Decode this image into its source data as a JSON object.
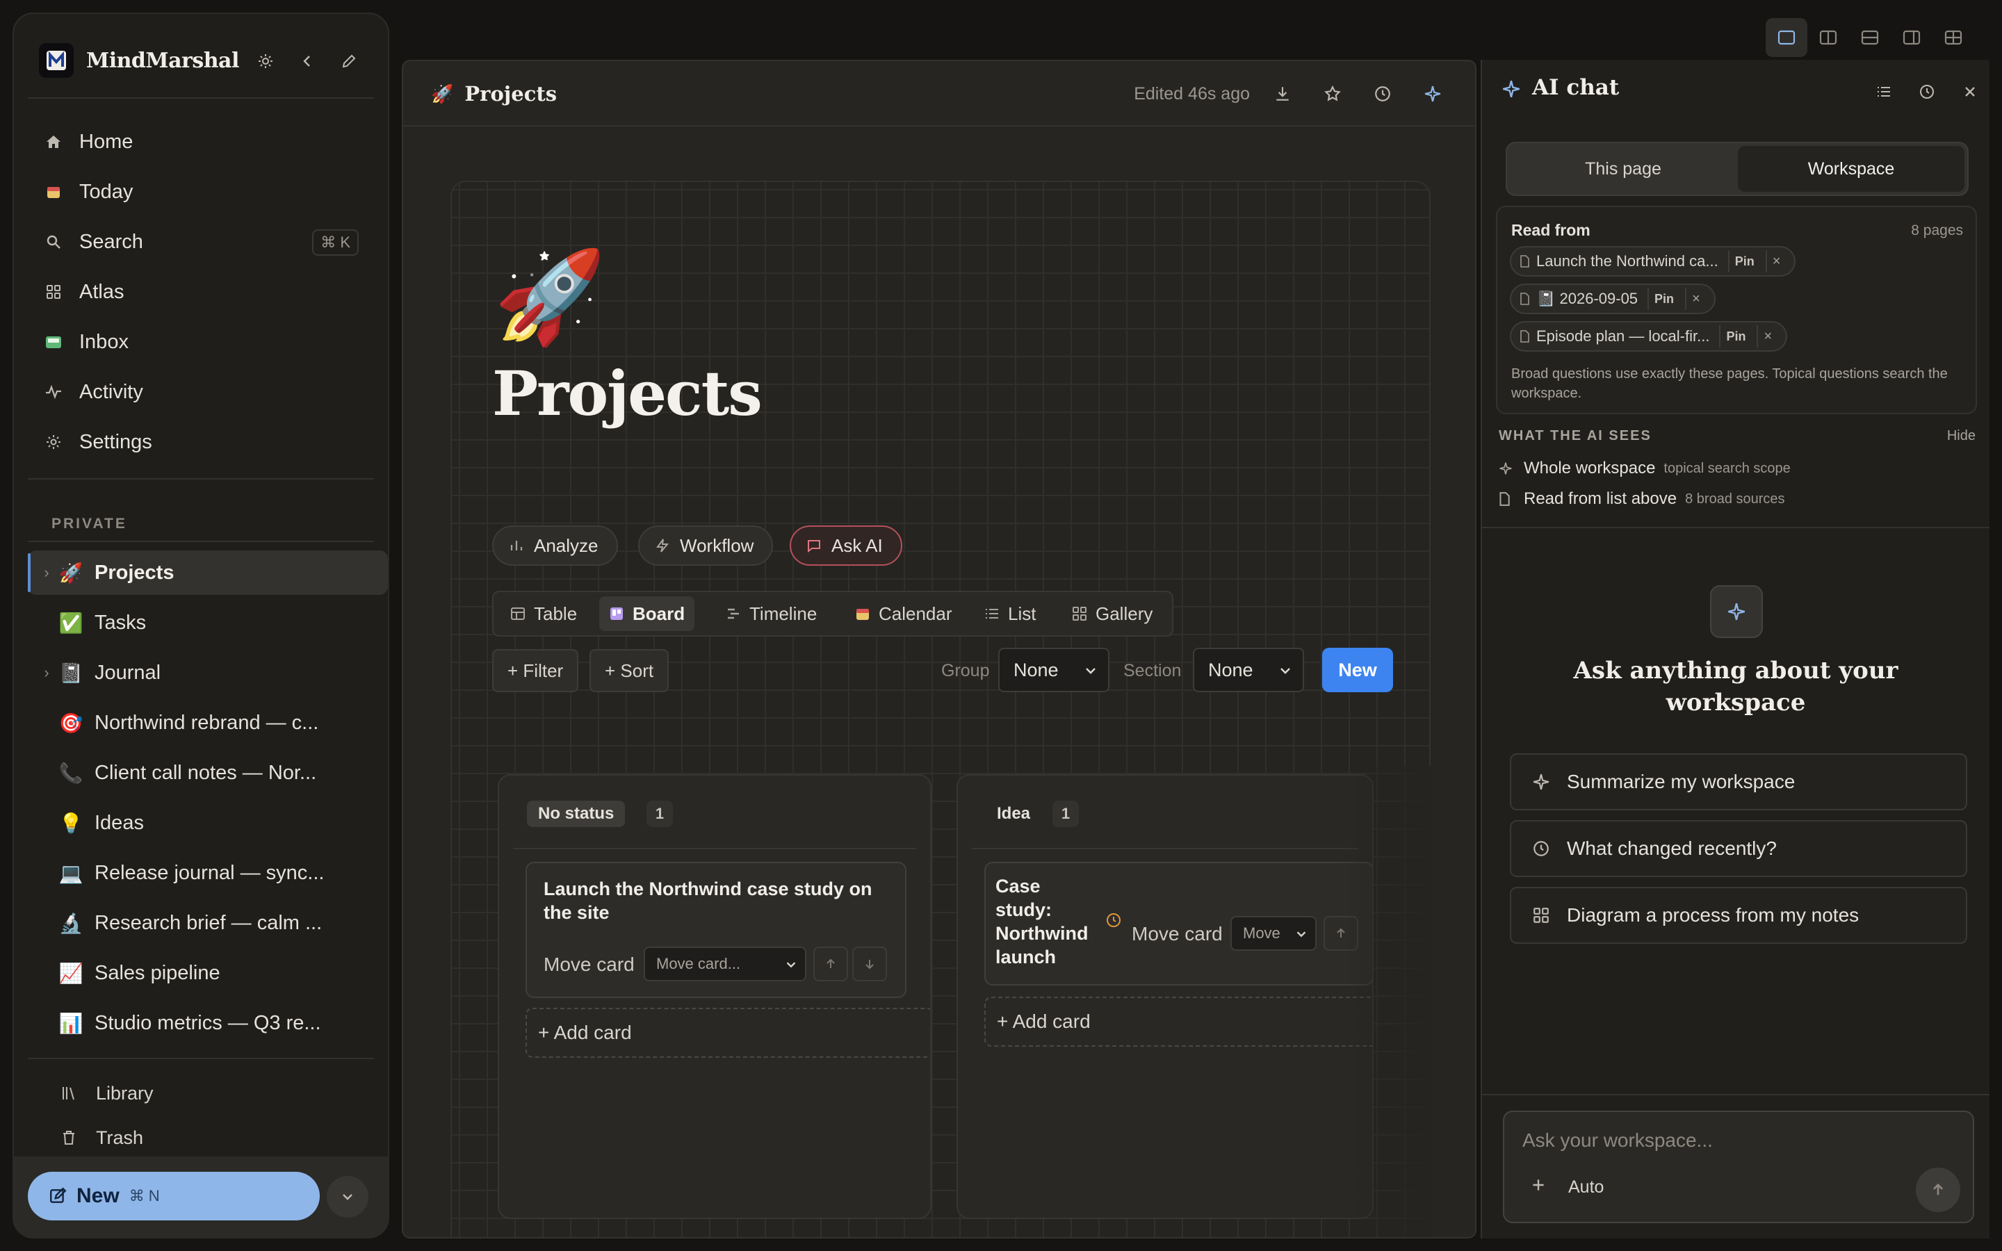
{
  "app": {
    "name": "MindMarshal"
  },
  "sidebar": {
    "nav": [
      {
        "label": "Home",
        "icon": "home-icon"
      },
      {
        "label": "Today",
        "icon": "calendar-icon"
      },
      {
        "label": "Search",
        "icon": "search-icon",
        "shortcut": "⌘ K"
      },
      {
        "label": "Atlas",
        "icon": "grid-icon"
      },
      {
        "label": "Inbox",
        "icon": "inbox-icon"
      },
      {
        "label": "Activity",
        "icon": "activity-icon"
      },
      {
        "label": "Settings",
        "icon": "gear-icon"
      }
    ],
    "section_label": "PRIVATE",
    "tree": [
      {
        "label": "Projects",
        "emoji": "🚀",
        "expandable": true,
        "active": true
      },
      {
        "label": "Tasks",
        "emoji": "✅"
      },
      {
        "label": "Journal",
        "emoji": "📓",
        "expandable": true
      },
      {
        "label": "Northwind rebrand — c...",
        "emoji": "🎯"
      },
      {
        "label": "Client call notes — Nor...",
        "emoji": "📞"
      },
      {
        "label": "Ideas",
        "emoji": "💡"
      },
      {
        "label": "Release journal — sync...",
        "emoji": "💻"
      },
      {
        "label": "Research brief — calm ...",
        "emoji": "🔬"
      },
      {
        "label": "Sales pipeline",
        "emoji": "📈"
      },
      {
        "label": "Studio metrics — Q3 re...",
        "emoji": "📊"
      }
    ],
    "footer": [
      {
        "label": "Library",
        "icon": "library-icon"
      },
      {
        "label": "Trash",
        "icon": "trash-icon"
      }
    ],
    "new_button": {
      "label": "New",
      "shortcut": "⌘ N"
    }
  },
  "editor": {
    "header_emoji": "🚀",
    "header_title": "Projects",
    "edited": "Edited 46s ago",
    "page_emoji": "🚀",
    "page_title": "Projects",
    "actions": [
      "Analyze",
      "Workflow",
      "Ask AI"
    ],
    "views": [
      "Table",
      "Board",
      "Timeline",
      "Calendar",
      "List",
      "Gallery"
    ],
    "active_view": "Board",
    "filter_label": "+ Filter",
    "sort_label": "+ Sort",
    "group_label": "Group",
    "group_value": "None",
    "section_label": "Section",
    "section_value": "None",
    "new_label": "New",
    "columns": [
      {
        "status": "No status",
        "count": "1",
        "cards": [
          {
            "title": "Launch the Northwind case study on the site",
            "move_label": "Move card",
            "move_select": "Move card..."
          }
        ],
        "add_label": "+ Add card"
      },
      {
        "status": "Idea",
        "count": "1",
        "cards": [
          {
            "title": "Case study: Northwind launch",
            "move_label": "Move card",
            "move_select": "Move"
          }
        ],
        "add_label": "+ Add card"
      }
    ]
  },
  "chat": {
    "title": "AI chat",
    "scope_tabs": [
      "This page",
      "Workspace"
    ],
    "active_scope": "Workspace",
    "read_from": {
      "title": "Read from",
      "count": "8 pages",
      "sources": [
        {
          "label": "Launch the Northwind ca...",
          "pin": "Pin",
          "remove": "×"
        },
        {
          "label": "📓 2026-09-05",
          "pin": "Pin",
          "remove": "×"
        },
        {
          "label": "Episode plan — local-fir...",
          "pin": "Pin",
          "remove": "×"
        }
      ],
      "note": "Broad questions use exactly these pages. Topical questions search the workspace."
    },
    "sees": {
      "label": "WHAT THE AI SEES",
      "hide": "Hide",
      "rows": [
        {
          "main": "Whole workspace",
          "sub": "topical search scope"
        },
        {
          "main": "Read from list above",
          "sub": "8 broad sources"
        }
      ]
    },
    "empty_title": "Ask anything about your workspace",
    "suggestions": [
      "Summarize my workspace",
      "What changed recently?",
      "Diagram a process from my notes"
    ],
    "composer": {
      "placeholder": "Ask your workspace...",
      "mode": "Auto"
    }
  },
  "colors": {
    "accent": "#3d84f0",
    "new_button": "#8fb6e8",
    "ask_ai_border": "#b4505a"
  }
}
